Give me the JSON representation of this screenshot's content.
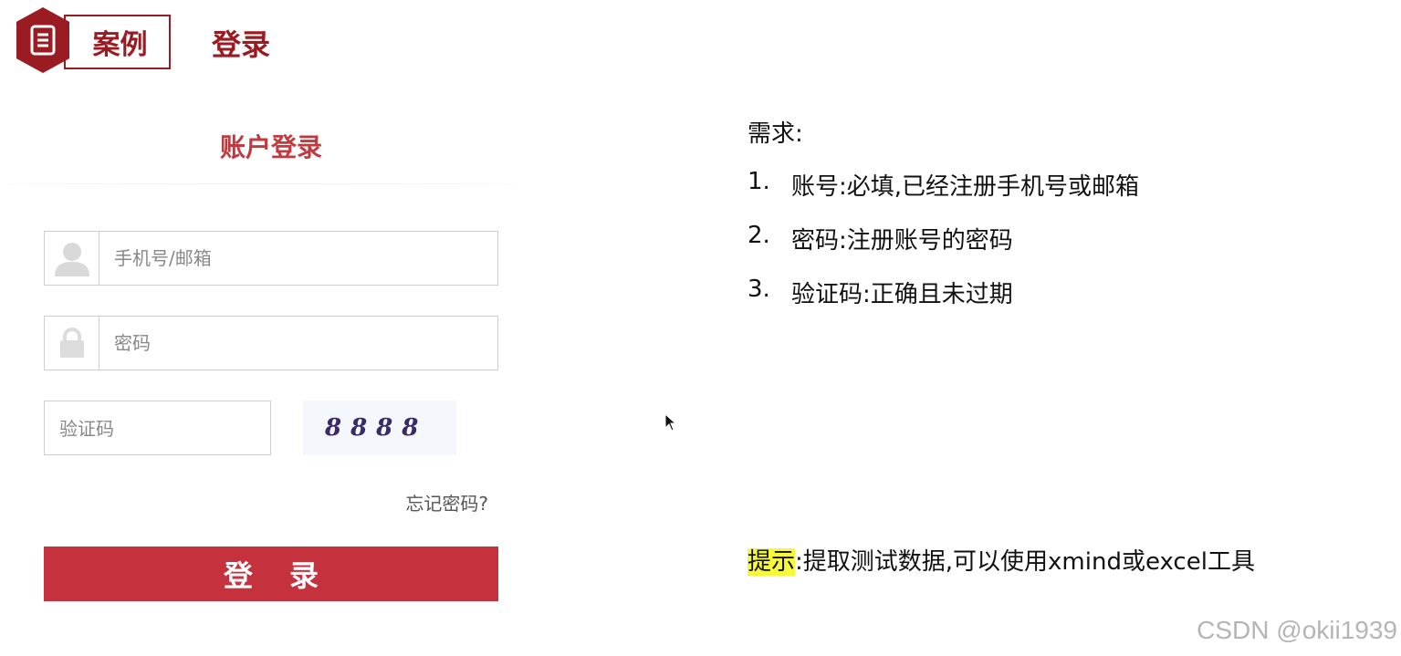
{
  "header": {
    "badge_label": "案例",
    "topic": "登录"
  },
  "login_form": {
    "title": "账户登录",
    "username_placeholder": "手机号/邮箱",
    "password_placeholder": "密码",
    "captcha_placeholder": "验证码",
    "captcha_text": "8888",
    "forgot_password": "忘记密码?",
    "submit_label": "登录"
  },
  "requirements": {
    "heading": "需求:",
    "items": [
      {
        "num": "1.",
        "text": "账号:必填,已经注册手机号或邮箱"
      },
      {
        "num": "2.",
        "text": "密码:注册账号的密码"
      },
      {
        "num": "3.",
        "text": "验证码:正确且未过期"
      }
    ]
  },
  "tip": {
    "label": "提示",
    "text": ":提取测试数据,可以使用xmind或excel工具"
  },
  "watermark": "CSDN @okii1939",
  "colors": {
    "brand": "#9b1b22",
    "title_red": "#c23a3f",
    "button": "#c5313d",
    "highlight": "#f6f93a"
  },
  "icons": {
    "badge": "document-icon",
    "username": "user-icon",
    "password": "lock-icon",
    "cursor": "mouse-cursor-icon"
  }
}
